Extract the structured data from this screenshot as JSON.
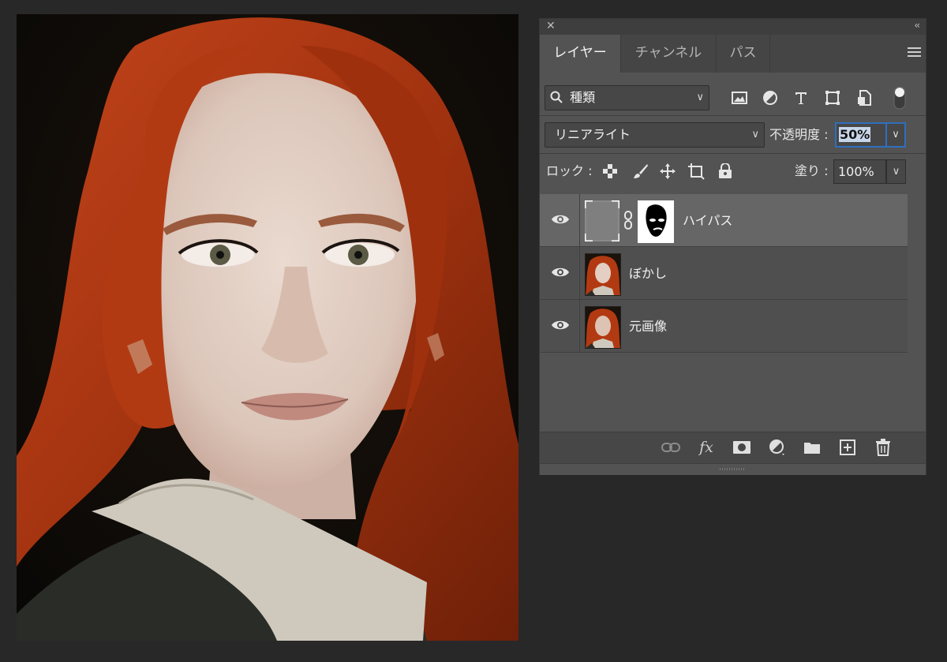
{
  "canvas": {
    "description_icon": "portrait-photo"
  },
  "panel": {
    "close_glyph": "✕",
    "collapse_glyph": "‹‹",
    "tabs": [
      {
        "label": "レイヤー",
        "active": true
      },
      {
        "label": "チャンネル",
        "active": false
      },
      {
        "label": "パス",
        "active": false
      }
    ],
    "filter": {
      "label": "種類",
      "icons": [
        "image-filter-icon",
        "adjustment-filter-icon",
        "type-filter-icon",
        "shape-filter-icon",
        "smart-object-filter-icon",
        "filter-toggle-icon"
      ]
    },
    "blend_mode": "リニアライト",
    "opacity_label": "不透明度 :",
    "opacity_value": "50%",
    "lock_label": "ロック :",
    "lock_icons": [
      "lock-transparency-icon",
      "lock-pixels-icon",
      "lock-position-icon",
      "lock-artboard-icon",
      "lock-all-icon"
    ],
    "fill_label": "塗り :",
    "fill_value": "100%",
    "layers": [
      {
        "name": "ハイパス",
        "selected": true,
        "visible": true,
        "has_mask": true
      },
      {
        "name": "ぼかし",
        "selected": false,
        "visible": true,
        "has_mask": false
      },
      {
        "name": "元画像",
        "selected": false,
        "visible": true,
        "has_mask": false
      }
    ],
    "bottom_icons": [
      "link-layers-icon",
      "fx-icon",
      "add-mask-icon",
      "new-adjustment-icon",
      "new-group-icon",
      "new-layer-icon",
      "delete-icon"
    ],
    "fx_label": "fx"
  },
  "colors": {
    "panel_bg": "#535353",
    "selected_layer": "#666666",
    "focus_blue": "#2f6fbd",
    "app_bg": "#282828"
  }
}
